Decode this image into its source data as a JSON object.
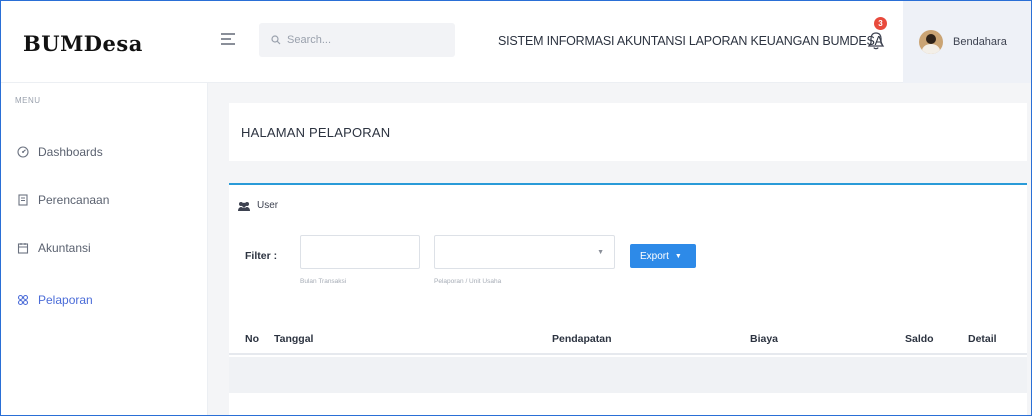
{
  "header": {
    "logo": "BUMDesa",
    "search_placeholder": "Search...",
    "app_title": "SISTEM INFORMASI AKUNTANSI LAPORAN KEUANGAN BUMDESA",
    "notification_count": "3",
    "user_name": "Bendahara"
  },
  "sidebar": {
    "menu_label": "MENU",
    "items": [
      {
        "label": "Dashboards",
        "icon": "dashboard-icon",
        "active": false
      },
      {
        "label": "Perencanaan",
        "icon": "document-icon",
        "active": false
      },
      {
        "label": "Akuntansi",
        "icon": "calendar-icon",
        "active": false
      },
      {
        "label": "Pelaporan",
        "icon": "grid-icon",
        "active": true
      }
    ]
  },
  "page": {
    "title": "HALAMAN PELAPORAN"
  },
  "card": {
    "title": "User",
    "filter_label": "Filter :",
    "month_hint": "Bulan Transaksi",
    "unit_hint": "Pelaporan / Unit Usaha",
    "export_label": "Export"
  },
  "table": {
    "columns": [
      "No",
      "Tanggal",
      "Pendapatan",
      "Biaya",
      "Saldo",
      "Detail"
    ]
  },
  "colors": {
    "accent": "#2d8ae8",
    "card_border": "#2a9bd8",
    "active_nav": "#4b6cd8",
    "badge": "#e84a3c"
  }
}
